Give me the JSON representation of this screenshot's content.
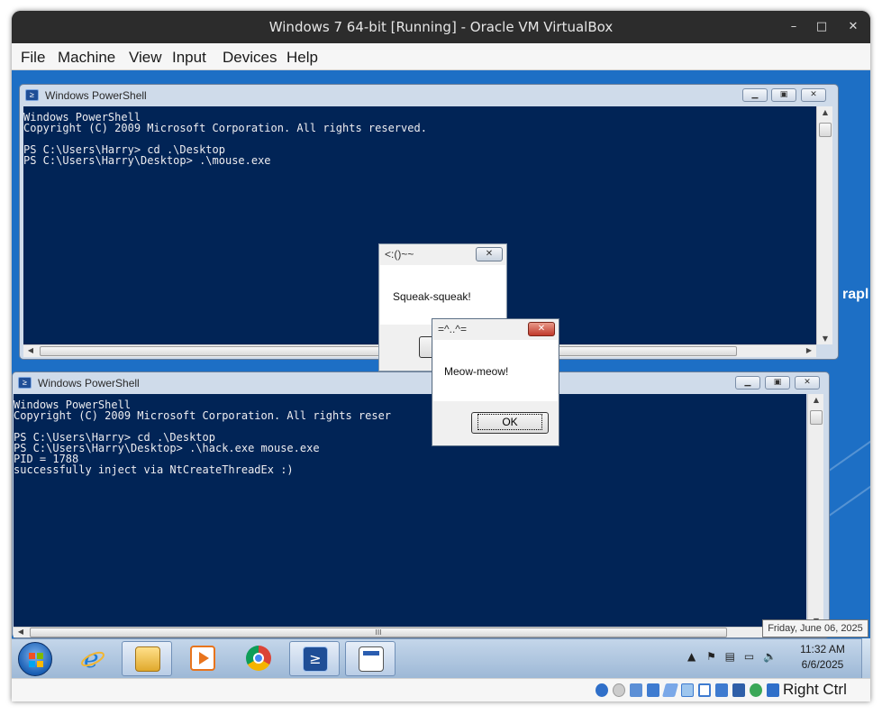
{
  "window": {
    "title": "Windows 7 64-bit [Running] - Oracle VM VirtualBox",
    "controls": {
      "minimize": "–",
      "maximize": "□",
      "close": "✕"
    }
  },
  "menu": [
    "File",
    "Machine",
    "View",
    "Input",
    "Devices",
    "Help"
  ],
  "desktop": {
    "partial_text": "rapl"
  },
  "powershell_top": {
    "title": "Windows PowerShell",
    "lines": [
      "Windows PowerShell",
      "Copyright (C) 2009 Microsoft Corporation. All rights reserved.",
      "",
      "PS C:\\Users\\Harry> cd .\\Desktop",
      "PS C:\\Users\\Harry\\Desktop> .\\mouse.exe"
    ]
  },
  "powershell_bottom": {
    "title": "Windows PowerShell",
    "lines": [
      "Windows PowerShell",
      "Copyright (C) 2009 Microsoft Corporation. All rights reser",
      "",
      "PS C:\\Users\\Harry> cd .\\Desktop",
      "PS C:\\Users\\Harry\\Desktop> .\\hack.exe mouse.exe",
      "PID = 1788",
      "successfully inject via NtCreateThreadEx :)"
    ],
    "hscroll_grip": "III"
  },
  "msgbox_mouse": {
    "title": "<:()~~",
    "text": "Squeak-squeak!"
  },
  "msgbox_meow": {
    "title": "=^..^=",
    "text": "Meow-meow!",
    "ok": "OK"
  },
  "taskbar": {
    "apps": [
      "windows-explorer",
      "internet-explorer",
      "file-explorer",
      "media-player",
      "chrome",
      "powershell",
      "application-window"
    ]
  },
  "clock": {
    "time": "11:32 AM",
    "date": "6/6/2025",
    "tooltip": "Friday, June 06, 2025"
  },
  "statusbar": {
    "host_key": "Right Ctrl"
  },
  "colors": {
    "ps_background": "#012456",
    "ps_text": "#eeedf0",
    "desktop": "#1d6fc5"
  }
}
